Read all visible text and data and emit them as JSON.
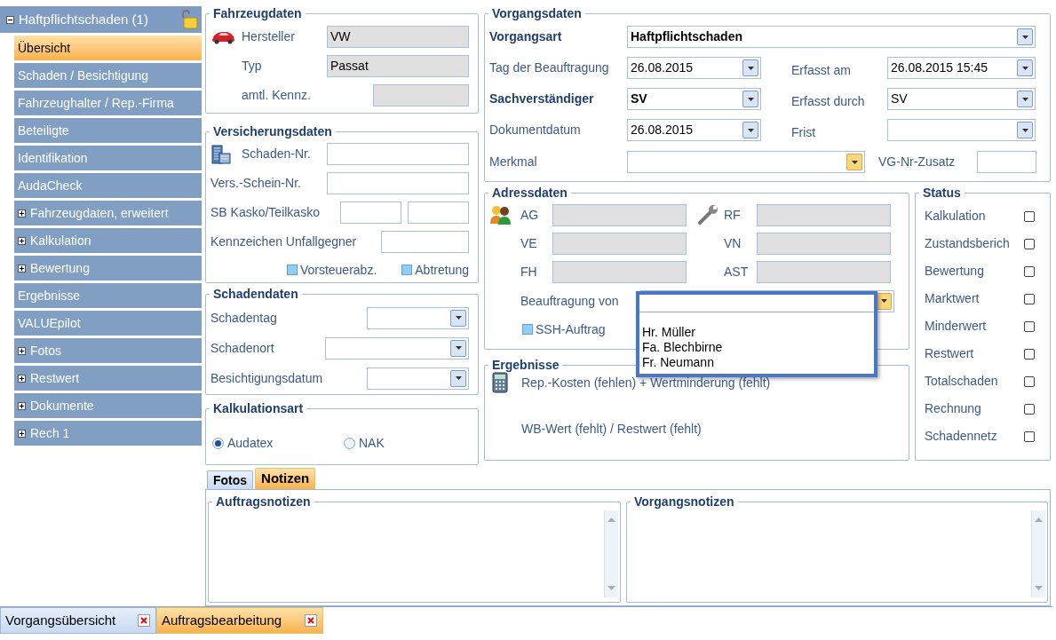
{
  "sidebar": {
    "header": {
      "label": "Haftpflichtschaden (1)",
      "expanded": true
    },
    "items": [
      {
        "label": "Übersicht",
        "selected": true,
        "expandable": false
      },
      {
        "label": "Schaden / Besichtigung",
        "selected": false,
        "expandable": false
      },
      {
        "label": "Fahrzeughalter / Rep.-Firma",
        "selected": false,
        "expandable": false
      },
      {
        "label": "Beteiligte",
        "selected": false,
        "expandable": false
      },
      {
        "label": "Identifikation",
        "selected": false,
        "expandable": false
      },
      {
        "label": "AudaCheck",
        "selected": false,
        "expandable": false
      },
      {
        "label": "Fahrzeugdaten, erweitert",
        "selected": false,
        "expandable": true
      },
      {
        "label": "Kalkulation",
        "selected": false,
        "expandable": true
      },
      {
        "label": "Bewertung",
        "selected": false,
        "expandable": true
      },
      {
        "label": "Ergebnisse",
        "selected": false,
        "expandable": false
      },
      {
        "label": "VALUEpilot",
        "selected": false,
        "expandable": false
      },
      {
        "label": "Fotos",
        "selected": false,
        "expandable": true
      },
      {
        "label": "Restwert",
        "selected": false,
        "expandable": true
      },
      {
        "label": "Dokumente",
        "selected": false,
        "expandable": true
      },
      {
        "label": "Rech 1",
        "selected": false,
        "expandable": true
      }
    ]
  },
  "fahrzeugdaten": {
    "title": "Fahrzeugdaten",
    "fields": [
      {
        "label": "Hersteller",
        "kind": "readonly",
        "value": "VW"
      },
      {
        "label": "Typ",
        "kind": "readonly",
        "value": "Passat"
      },
      {
        "label": "amtl. Kennz.",
        "kind": "readonly"
      }
    ]
  },
  "versicherungsdaten": {
    "title": "Versicherungsdaten",
    "fields": [
      {
        "label": "Schaden-Nr.",
        "kind": "input"
      },
      {
        "label": "Vers.-Schein-Nr.",
        "kind": "input"
      },
      {
        "label": "SB Kasko/Teilkasko",
        "kind": "pair"
      },
      {
        "label": "Kennzeichen Unfallgegner",
        "kind": "input"
      }
    ],
    "options": [
      {
        "label": "Vorsteuerabz.",
        "checked": true
      },
      {
        "label": "Abtretung",
        "checked": true
      }
    ]
  },
  "schadendaten": {
    "title": "Schadendaten",
    "fields": [
      {
        "label": "Schadentag",
        "kind": "dropdown",
        "highlighted": false
      },
      {
        "label": "Schadenort",
        "kind": "dropdown",
        "highlighted": false
      },
      {
        "label": "Besichtigungsdatum",
        "kind": "dropdown",
        "highlighted": false
      }
    ]
  },
  "kalkulationsart": {
    "title": "Kalkulationsart",
    "options": [
      {
        "label": "Audatex",
        "selected": true
      },
      {
        "label": "NAK",
        "selected": false
      }
    ]
  },
  "vorgangsdaten": {
    "title": "Vorgangsdaten",
    "fields": [
      {
        "label": "Vorgangsart",
        "kind": "dropdown",
        "required": true,
        "highlighted": false,
        "value": "Haftpflichtschaden"
      },
      {
        "label": "Tag der Beauftragung",
        "kind": "dropdown",
        "required": false,
        "highlighted": false,
        "value": "26.08.2015"
      },
      {
        "label": "Erfasst am",
        "kind": "dropdown",
        "required": false,
        "highlighted": false,
        "value": "26.08.2015 15:45"
      },
      {
        "label": "Sachverständiger",
        "kind": "dropdown",
        "required": true,
        "highlighted": false,
        "value": "SV"
      },
      {
        "label": "Erfasst durch",
        "kind": "dropdown",
        "required": false,
        "highlighted": false,
        "value": "SV"
      },
      {
        "label": "Dokumentdatum",
        "kind": "dropdown",
        "required": false,
        "highlighted": false,
        "value": "26.08.2015"
      },
      {
        "label": "Frist",
        "kind": "dropdown",
        "required": false,
        "highlighted": false
      },
      {
        "label": "Merkmal",
        "kind": "dropdown",
        "required": false,
        "highlighted": true
      },
      {
        "label": "VG-Nr-Zusatz",
        "kind": "input",
        "required": false
      }
    ]
  },
  "adressdaten": {
    "title": "Adressdaten",
    "fields": [
      {
        "label": "AG",
        "kind": "readonly"
      },
      {
        "label": "RF",
        "kind": "readonly"
      },
      {
        "label": "VE",
        "kind": "readonly"
      },
      {
        "label": "VN",
        "kind": "readonly"
      },
      {
        "label": "FH",
        "kind": "readonly"
      },
      {
        "label": "AST",
        "kind": "readonly"
      }
    ],
    "beauftragung": {
      "label": "Beauftragung von",
      "highlighted": true,
      "expanded": true,
      "options": [
        "Hr. Müller",
        "Fa. Blechbirne",
        "Fr. Neumann"
      ]
    },
    "options": [
      {
        "label": "SSH-Auftrag",
        "checked": true
      }
    ]
  },
  "ergebnisse": {
    "title": "Ergebnisse",
    "lines": [
      "Rep.-Kosten (fehlen) + Wertminderung (fehlt)",
      "WB-Wert (fehlt) / Restwert (fehlt)"
    ]
  },
  "status": {
    "title": "Status",
    "items": [
      {
        "label": "Kalkulation",
        "checked": false
      },
      {
        "label": "Zustandsberich",
        "checked": false
      },
      {
        "label": "Bewertung",
        "checked": false
      },
      {
        "label": "Marktwert",
        "checked": false
      },
      {
        "label": "Minderwert",
        "checked": false
      },
      {
        "label": "Restwert",
        "checked": false
      },
      {
        "label": "Totalschaden",
        "checked": false
      },
      {
        "label": "Rechnung",
        "checked": false
      },
      {
        "label": "Schadennetz",
        "checked": false
      }
    ]
  },
  "notes_tabs": [
    {
      "label": "Fotos",
      "selected": false
    },
    {
      "label": "Notizen",
      "selected": true
    }
  ],
  "note_panels": [
    {
      "title": "Auftragsnotizen"
    },
    {
      "title": "Vorgangsnotizen"
    }
  ],
  "document_tabs": [
    {
      "label": "Vorgangsübersicht",
      "selected": false
    },
    {
      "label": "Auftragsbearbeitung",
      "selected": true
    }
  ]
}
